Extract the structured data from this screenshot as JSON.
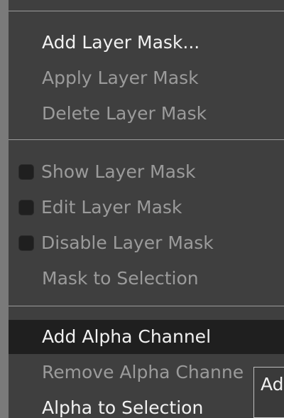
{
  "menu": {
    "add_layer_mask": "Add Layer Mask...",
    "apply_layer_mask": "Apply Layer Mask",
    "delete_layer_mask": "Delete Layer Mask",
    "show_layer_mask": "Show Layer Mask",
    "edit_layer_mask": "Edit Layer Mask",
    "disable_layer_mask": "Disable Layer Mask",
    "mask_to_selection": "Mask to Selection",
    "add_alpha_channel": "Add Alpha Channel",
    "remove_alpha_channel": "Remove Alpha Channe",
    "alpha_to_selection": "Alpha to Selection"
  },
  "tooltip": {
    "text": "Ad"
  }
}
